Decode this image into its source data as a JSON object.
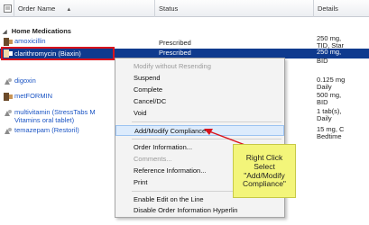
{
  "header": {
    "sort_indicator": "▲",
    "order_name": "Order Name",
    "status": "Status",
    "details": "Details"
  },
  "section": {
    "title": "Home Medications"
  },
  "rows": [
    {
      "name": "amoxicillin",
      "status": "Prescribed",
      "details_1": "250 mg,",
      "details_2": "TID, Star"
    },
    {
      "name": "clarithromycin (Biaxin)",
      "status": "Prescribed",
      "details_1": "250 mg,",
      "details_2": "BID"
    },
    {
      "name": "digoxin",
      "status": "",
      "details_1": "0.125 mg",
      "details_2": "Daily"
    },
    {
      "name": "metFORMIN",
      "status": "",
      "details_1": "500 mg,",
      "details_2": "BID"
    },
    {
      "name_1": "multivitamin (StressTabs M",
      "name_2": "Vitamins oral tablet)",
      "status": "",
      "details_1": "1 tab(s),",
      "details_2": "Daily"
    },
    {
      "name": "temazepam (Restoril)",
      "status": "",
      "details_1": "15 mg, C",
      "details_2": "Bedtime"
    }
  ],
  "context_menu": {
    "items": [
      "Modify without Resending",
      "Suspend",
      "Complete",
      "Cancel/DC",
      "Void",
      "Add/Modify Compliance",
      "Order Information...",
      "Comments...",
      "Reference Information...",
      "Print",
      "Enable Edit on the Line",
      "Disable Order Information Hyperlin"
    ]
  },
  "callout": {
    "line1": "Right Click",
    "line2": "Select",
    "line3": "\"Add/Modify",
    "line4": "Compliance\""
  },
  "colors": {
    "selection": "#0f3a8e",
    "highlight_box": "#d9131c",
    "link_text": "#1a54c4",
    "callout_bg": "#f3f57a"
  }
}
